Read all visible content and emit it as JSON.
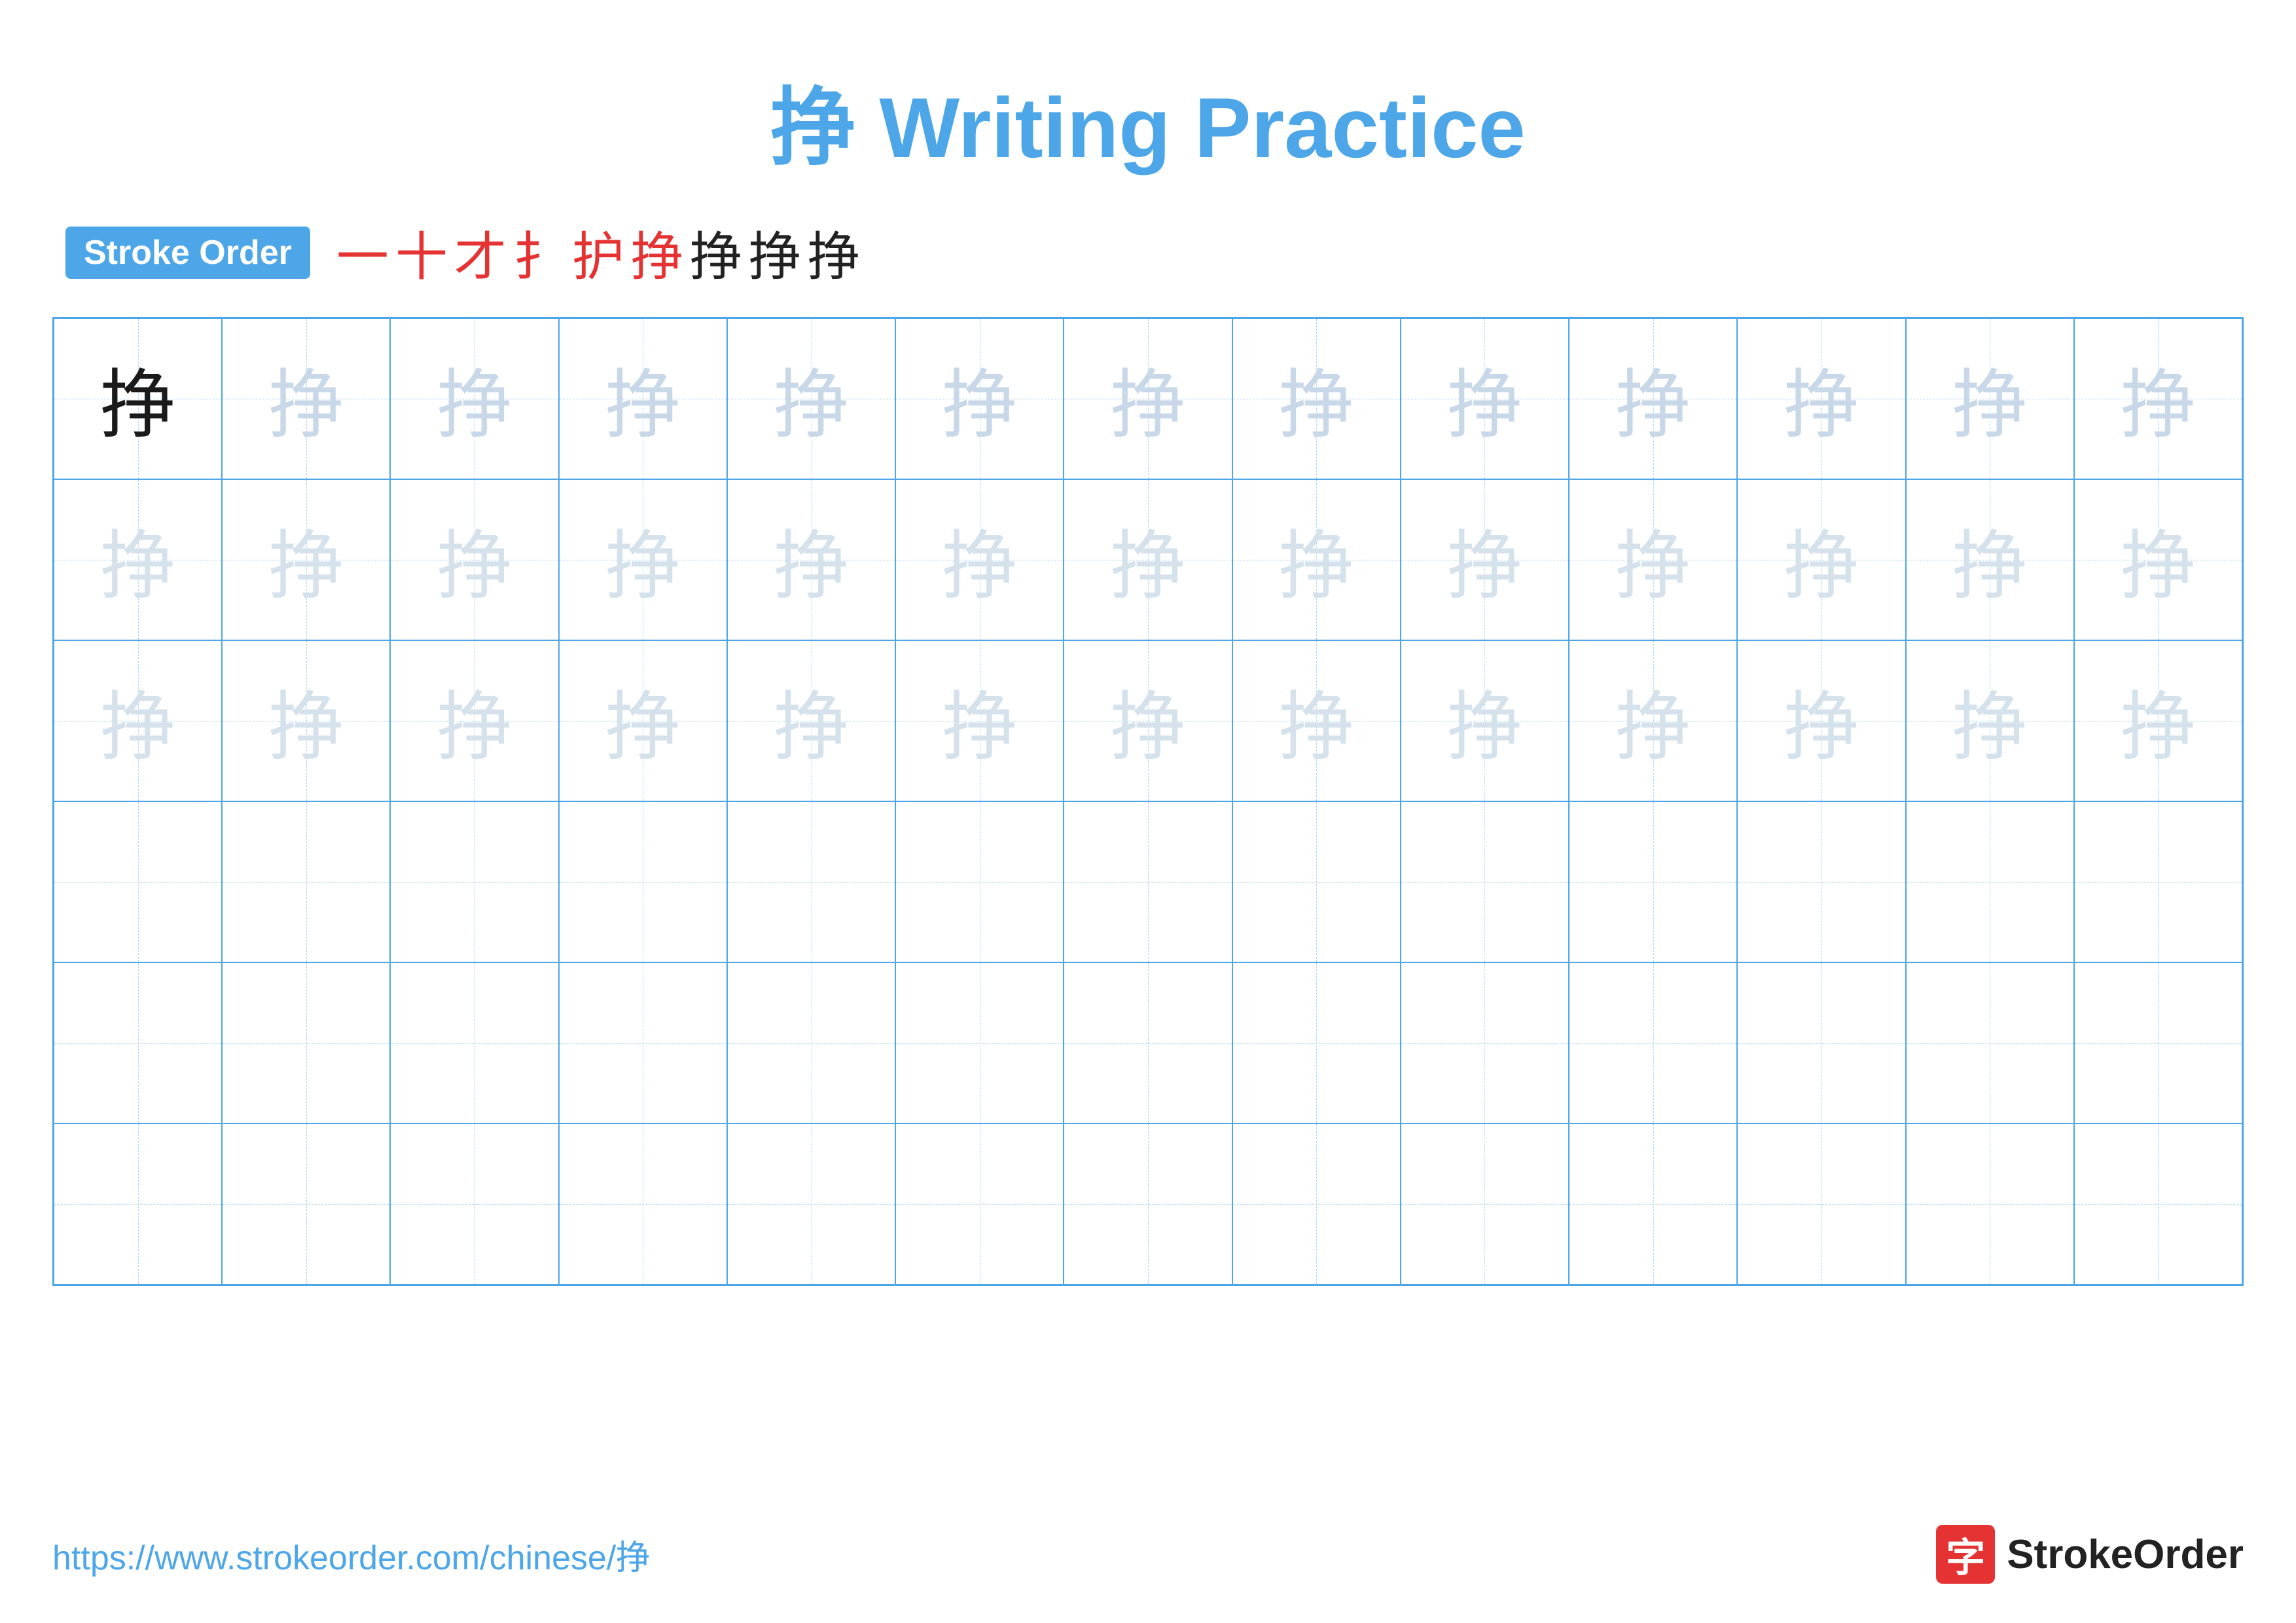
{
  "title": {
    "char": "挣",
    "text": "Writing Practice",
    "full": "挣 Writing Practice"
  },
  "stroke_order": {
    "badge_label": "Stroke Order",
    "strokes": [
      "一",
      "十",
      "才",
      "扌",
      "护",
      "挣",
      "挣",
      "挣",
      "挣"
    ]
  },
  "grid": {
    "rows": 6,
    "cols": 13,
    "char": "挣"
  },
  "footer": {
    "url": "https://www.strokeorder.com/chinese/挣",
    "logo_char": "字",
    "logo_name": "StrokeOrder"
  }
}
